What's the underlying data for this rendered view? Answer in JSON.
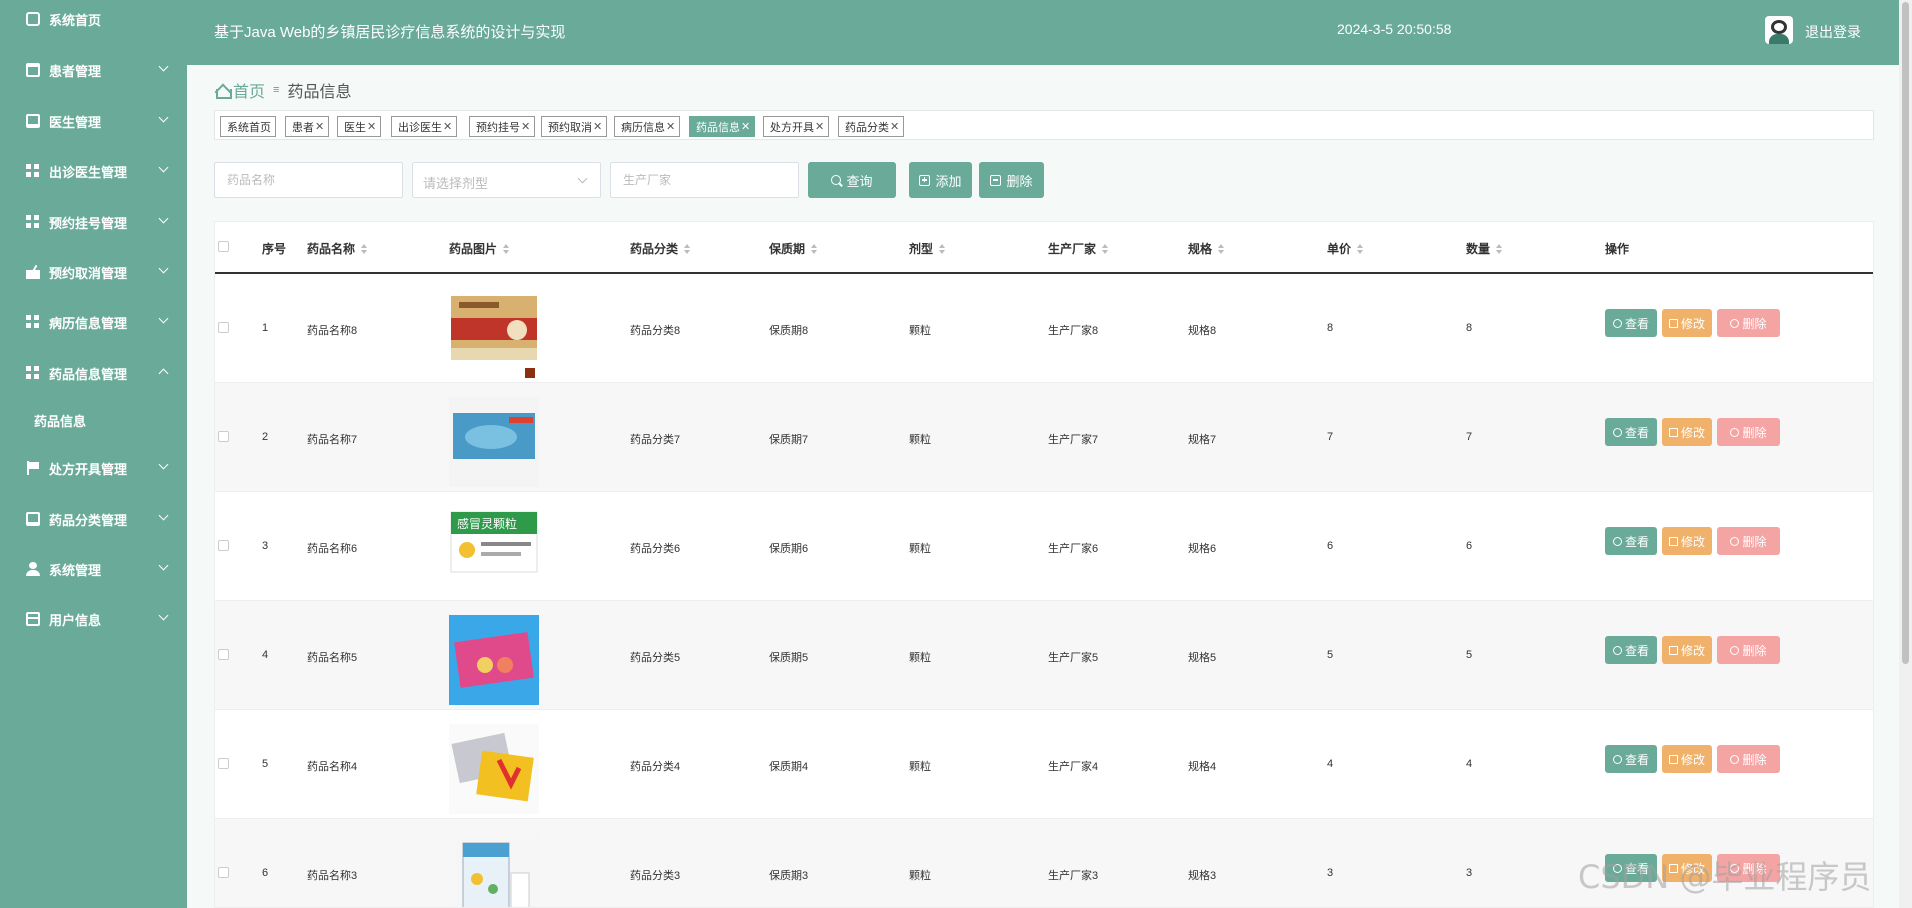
{
  "sidebar": {
    "items": [
      {
        "label": "系统首页",
        "icon": "home-icon"
      },
      {
        "label": "患者管理",
        "icon": "briefcase-icon"
      },
      {
        "label": "医生管理",
        "icon": "monitor-icon"
      },
      {
        "label": "出诊医生管理",
        "icon": "grid-icon"
      },
      {
        "label": "预约挂号管理",
        "icon": "grid-icon"
      },
      {
        "label": "预约取消管理",
        "icon": "cancel-icon"
      },
      {
        "label": "病历信息管理",
        "icon": "grid-icon"
      },
      {
        "label": "药品信息管理",
        "icon": "grid-icon"
      },
      {
        "label": "处方开具管理",
        "icon": "flag-icon"
      },
      {
        "label": "药品分类管理",
        "icon": "monitor-icon"
      },
      {
        "label": "系统管理",
        "icon": "user-icon"
      },
      {
        "label": "用户信息",
        "icon": "calendar-icon"
      }
    ],
    "sub_item": "药品信息"
  },
  "header": {
    "title": "基于Java Web的乡镇居民诊疗信息系统的设计与实现",
    "datetime": "2024-3-5 20:50:58",
    "logout": "退出登录"
  },
  "breadcrumb": {
    "home": "首页",
    "separator": "≡",
    "current": "药品信息"
  },
  "tabs": [
    {
      "label": "系统首页",
      "closable": false
    },
    {
      "label": "患者",
      "closable": true
    },
    {
      "label": "医生",
      "closable": true
    },
    {
      "label": "出诊医生",
      "closable": true
    },
    {
      "label": "预约挂号",
      "closable": true
    },
    {
      "label": "预约取消",
      "closable": true
    },
    {
      "label": "病历信息",
      "closable": true
    },
    {
      "label": "药品信息",
      "closable": true
    },
    {
      "label": "处方开具",
      "closable": true
    },
    {
      "label": "药品分类",
      "closable": true
    }
  ],
  "filters": {
    "name_placeholder": "药品名称",
    "type_placeholder": "请选择剂型",
    "maker_placeholder": "生产厂家",
    "search_label": "查询",
    "add_label": "添加",
    "delete_label": "删除"
  },
  "table": {
    "columns": [
      "序号",
      "药品名称",
      "药品图片",
      "药品分类",
      "保质期",
      "剂型",
      "生产厂家",
      "规格",
      "单价",
      "数量",
      "操作"
    ],
    "rows": [
      {
        "no": "1",
        "name": "药品名称8",
        "category": "药品分类8",
        "shelf": "保质期8",
        "form": "颗粒",
        "maker": "生产厂家8",
        "spec": "规格8",
        "price": "8",
        "qty": "8"
      },
      {
        "no": "2",
        "name": "药品名称7",
        "category": "药品分类7",
        "shelf": "保质期7",
        "form": "颗粒",
        "maker": "生产厂家7",
        "spec": "规格7",
        "price": "7",
        "qty": "7"
      },
      {
        "no": "3",
        "name": "药品名称6",
        "category": "药品分类6",
        "shelf": "保质期6",
        "form": "颗粒",
        "maker": "生产厂家6",
        "spec": "规格6",
        "price": "6",
        "qty": "6"
      },
      {
        "no": "4",
        "name": "药品名称5",
        "category": "药品分类5",
        "shelf": "保质期5",
        "form": "颗粒",
        "maker": "生产厂家5",
        "spec": "规格5",
        "price": "5",
        "qty": "5"
      },
      {
        "no": "5",
        "name": "药品名称4",
        "category": "药品分类4",
        "shelf": "保质期4",
        "form": "颗粒",
        "maker": "生产厂家4",
        "spec": "规格4",
        "price": "4",
        "qty": "4"
      },
      {
        "no": "6",
        "name": "药品名称3",
        "category": "药品分类3",
        "shelf": "保质期3",
        "form": "颗粒",
        "maker": "生产厂家3",
        "spec": "规格3",
        "price": "3",
        "qty": "3"
      }
    ],
    "actions": {
      "view": "查看",
      "edit": "修改",
      "delete": "删除"
    }
  },
  "image_text": {
    "box3": "感冒灵颗粒"
  },
  "watermark": "CSDN @毕业程序员",
  "colors": {
    "primary": "#6aaa98",
    "edit": "#f0b26b",
    "danger": "#f5a4a4"
  }
}
